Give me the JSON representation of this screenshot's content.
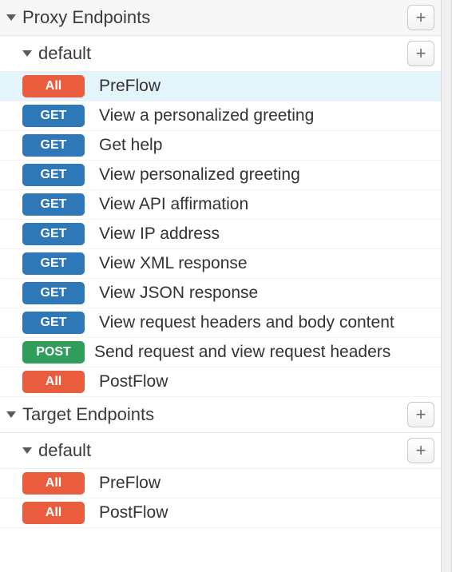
{
  "sections": [
    {
      "title": "Proxy Endpoints",
      "groups": [
        {
          "title": "default",
          "items": [
            {
              "method": "All",
              "label": "PreFlow",
              "selected": true
            },
            {
              "method": "GET",
              "label": "View a personalized greeting"
            },
            {
              "method": "GET",
              "label": "Get help"
            },
            {
              "method": "GET",
              "label": "View personalized greeting"
            },
            {
              "method": "GET",
              "label": "View API affirmation"
            },
            {
              "method": "GET",
              "label": "View IP address"
            },
            {
              "method": "GET",
              "label": "View XML response"
            },
            {
              "method": "GET",
              "label": "View JSON response"
            },
            {
              "method": "GET",
              "label": "View request headers and body content"
            },
            {
              "method": "POST",
              "label": "Send request and view request headers"
            },
            {
              "method": "All",
              "label": "PostFlow"
            }
          ]
        }
      ]
    },
    {
      "title": "Target Endpoints",
      "groups": [
        {
          "title": "default",
          "items": [
            {
              "method": "All",
              "label": "PreFlow"
            },
            {
              "method": "All",
              "label": "PostFlow"
            }
          ]
        }
      ]
    }
  ],
  "icons": {
    "add": "+"
  },
  "colors": {
    "all": "#e95c3e",
    "get": "#2e78b7",
    "post": "#2f9e5b",
    "selected_bg": "#e3f4fb"
  }
}
